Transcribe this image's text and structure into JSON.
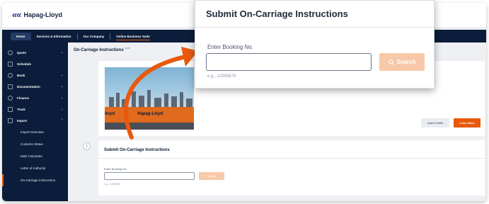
{
  "brand": {
    "logo_mark": "««",
    "logo_text": "Hapag-Lloyd"
  },
  "nav": {
    "items": [
      {
        "label": "Home",
        "active": true
      },
      {
        "label": "Services & Information"
      },
      {
        "label": "Our Company"
      },
      {
        "label": "Online Business Suite",
        "underlined": true
      }
    ]
  },
  "sidebar": {
    "items": [
      {
        "label": "Quote",
        "icon": "circle-icon",
        "chevron": "⌄"
      },
      {
        "label": "Schedule",
        "icon": "calendar-icon",
        "chevron": ""
      },
      {
        "label": "Book",
        "icon": "book-icon",
        "chevron": "⌄"
      },
      {
        "label": "Documentation",
        "icon": "document-icon",
        "chevron": "⌄"
      },
      {
        "label": "Finance",
        "icon": "finance-icon",
        "chevron": "⌄"
      },
      {
        "label": "Track",
        "icon": "track-icon",
        "chevron": "⌄"
      },
      {
        "label": "Import",
        "icon": "import-icon",
        "chevron": "⌃"
      }
    ],
    "sub_items": [
      {
        "label": "Import Overview"
      },
      {
        "label": "Customs Status"
      },
      {
        "label": "D&D Calculator"
      },
      {
        "label": "Letter of Authority"
      },
      {
        "label": "On-Carriage Instructions",
        "current": true
      }
    ]
  },
  "main": {
    "title": "On-Carriage Instructions",
    "title_badge": "BETA",
    "hero": {
      "container_text": "Hapag-Lloyd",
      "container_text_left": "lloyd"
    },
    "buttons": {
      "tariffs": "Inland Tariffs",
      "learn_more": "Learn More"
    },
    "step_marker": "1"
  },
  "submit_section": {
    "title": "Submit On-Carriage Instructions",
    "label": "Enter Booking No.",
    "input_value": "",
    "search_label": "Search",
    "hint": "e.g., 12345678"
  },
  "popup": {
    "title": "Submit On-Carriage Instructions",
    "label": "Enter Booking No.",
    "input_value": "",
    "search_label": "Search",
    "search_icon": "search-icon",
    "hint": "e.g., 12345678"
  },
  "colors": {
    "navy": "#0b1d3a",
    "accent_orange": "#e8590c",
    "disabled_orange": "#f8c9a8",
    "annotation_arrow": "#e8590c"
  }
}
